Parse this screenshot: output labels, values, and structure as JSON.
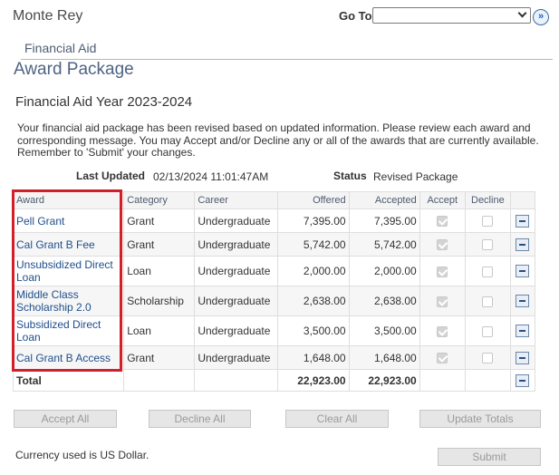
{
  "header": {
    "campus": "Monte Rey",
    "goto_label": "Go To",
    "goto_value": "",
    "goto_button_icon": "double-chevron-right-icon"
  },
  "section_label": "Financial Aid",
  "page_title": "Award Package",
  "aid_year": "Financial Aid Year 2023-2024",
  "message": "Your financial aid package has been revised based on updated information. Please review each award and corresponding message. You may Accept and/or Decline any or all of the awards that are currently available. Remember to 'Submit' your changes.",
  "status_info": {
    "last_updated_label": "Last Updated",
    "last_updated_value": "02/13/2024 11:01:47AM",
    "status_label": "Status",
    "status_value": "Revised Package"
  },
  "table": {
    "columns": [
      "Award",
      "Category",
      "Career",
      "Offered",
      "Accepted",
      "Accept",
      "Decline",
      ""
    ],
    "rows": [
      {
        "award": "Pell Grant",
        "category": "Grant",
        "career": "Undergraduate",
        "offered": "7,395.00",
        "accepted": "7,395.00",
        "accept": true,
        "decline": false
      },
      {
        "award": "Cal Grant B Fee",
        "category": "Grant",
        "career": "Undergraduate",
        "offered": "5,742.00",
        "accepted": "5,742.00",
        "accept": true,
        "decline": false
      },
      {
        "award": "Unsubsidized Direct Loan",
        "category": "Loan",
        "career": "Undergraduate",
        "offered": "2,000.00",
        "accepted": "2,000.00",
        "accept": true,
        "decline": false
      },
      {
        "award": "Middle Class Scholarship 2.0",
        "category": "Scholarship",
        "career": "Undergraduate",
        "offered": "2,638.00",
        "accepted": "2,638.00",
        "accept": true,
        "decline": false
      },
      {
        "award": "Subsidized Direct Loan",
        "category": "Loan",
        "career": "Undergraduate",
        "offered": "3,500.00",
        "accepted": "3,500.00",
        "accept": true,
        "decline": false
      },
      {
        "award": "Cal Grant B Access",
        "category": "Grant",
        "career": "Undergraduate",
        "offered": "1,648.00",
        "accepted": "1,648.00",
        "accept": true,
        "decline": false
      }
    ],
    "total": {
      "label": "Total",
      "offered": "22,923.00",
      "accepted": "22,923.00"
    },
    "highlight_color": "#d0212b"
  },
  "buttons": {
    "accept_all": "Accept All",
    "decline_all": "Decline All",
    "clear_all": "Clear All",
    "update_totals": "Update Totals",
    "submit": "Submit"
  },
  "currency_note": "Currency used is US Dollar."
}
